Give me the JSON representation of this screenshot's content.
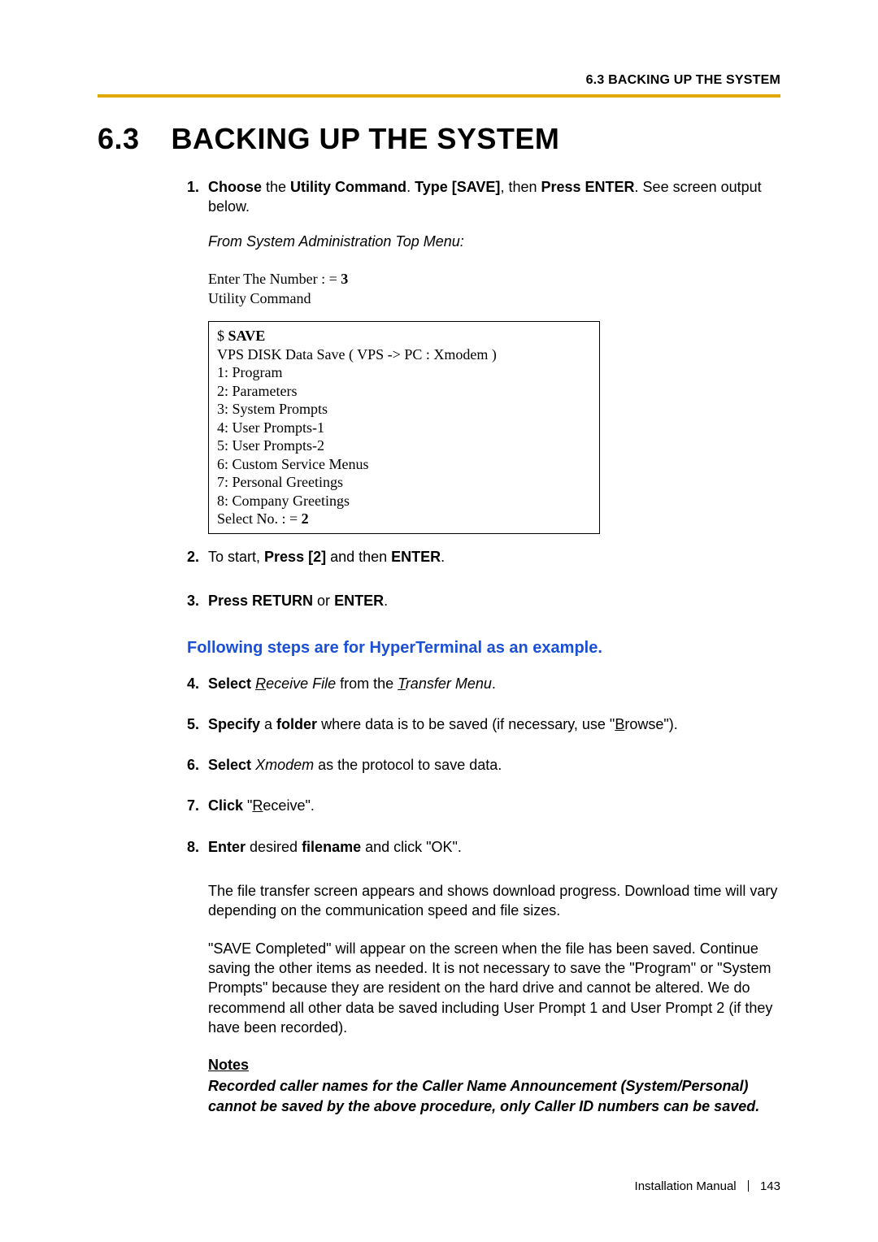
{
  "running_head": "6.3 BACKING UP THE SYSTEM",
  "section": {
    "number": "6.3",
    "title": "BACKING UP THE SYSTEM"
  },
  "step1": {
    "num": "1.",
    "text_parts": {
      "a": "Choose",
      "b": " the ",
      "c": "Utility Command",
      "d": ". ",
      "e": "Type [SAVE]",
      "f": ", then ",
      "g": "Press ENTER",
      "h": ". See screen output below."
    }
  },
  "from_menu": "From System Administration Top Menu:",
  "term_lines": {
    "l1_a": "Enter The Number : = ",
    "l1_b": "3",
    "l2": "Utility Command"
  },
  "term_box": {
    "l1_a": "$  ",
    "l1_b": "SAVE",
    "l2": "VPS DISK Data Save ( VPS -> PC : Xmodem )",
    "l3": "1:  Program",
    "l4": "2:  Parameters",
    "l5": "3:  System Prompts",
    "l6": "4:  User Prompts-1",
    "l7": "5:  User Prompts-2",
    "l8": "6:  Custom Service Menus",
    "l9": "7:  Personal Greetings",
    "l10": "8:  Company Greetings",
    "l11_a": "Select No. : = ",
    "l11_b": "2"
  },
  "step2": {
    "num": "2.",
    "a": "To start, ",
    "b": "Press [2]",
    "c": " and then ",
    "d": "ENTER",
    "e": "."
  },
  "step3": {
    "num": "3.",
    "a": "Press RETURN",
    "b": " or ",
    "c": "ENTER",
    "d": "."
  },
  "hyper_head": "Following steps are for HyperTerminal as an example.",
  "step4": {
    "num": "4.",
    "a": "Select",
    "b_u": "R",
    "b_rest": "eceive File",
    "c": " from the ",
    "d_u": "T",
    "d_rest": "ransfer Menu",
    "e": "."
  },
  "step5": {
    "num": "5.",
    "a": "Specify",
    "b": " a ",
    "c": "folder",
    "d": " where data is to be saved (if necessary, use \"",
    "e_u": "B",
    "e_rest": "rowse\")."
  },
  "step6": {
    "num": "6.",
    "a": "Select",
    "b": "Xmodem",
    "c": " as the protocol to save data."
  },
  "step7": {
    "num": "7.",
    "a": "Click",
    "b": " \"",
    "c_u": "R",
    "c_rest": "eceive\"."
  },
  "step8": {
    "num": "8.",
    "a": "Enter",
    "b": " desired ",
    "c": "filename",
    "d": " and click \"OK\"."
  },
  "para1": "The file transfer screen appears and shows download progress. Download time will vary depending on the communication speed and file sizes.",
  "para2": "\"SAVE Completed\" will appear on the screen when the file has been saved. Continue saving the other items as needed. It is not necessary to save the \"Program\" or \"System Prompts\" because they are resident on the hard drive and cannot be altered. We do recommend all other data be saved including User Prompt 1 and User Prompt 2 (if they have been recorded).",
  "notes_head": "Notes",
  "notes_body": "Recorded caller names for the Caller Name Announcement (System/Personal) cannot be saved by the above procedure, only Caller ID numbers can be saved.",
  "footer": {
    "manual": "Installation Manual",
    "page": "143"
  }
}
